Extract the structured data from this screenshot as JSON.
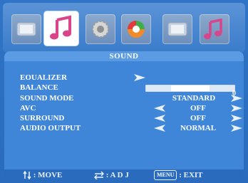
{
  "tabs": [
    {
      "icon": "picture-icon",
      "active": false
    },
    {
      "icon": "sound-music-icon",
      "active": true
    },
    {
      "icon": "settings-gear-icon",
      "active": false
    },
    {
      "icon": "color-disc-icon",
      "active": false
    },
    {
      "icon": "picture-icon",
      "active": false
    },
    {
      "icon": "sound-music-icon",
      "active": false
    }
  ],
  "menu": {
    "title": "SOUND",
    "items": [
      {
        "label": "EOUALIZER",
        "value": "",
        "has_left": false,
        "has_right": true
      },
      {
        "label": "BALANCE",
        "value": "0",
        "has_left": false,
        "has_right": false,
        "level": 0.5
      },
      {
        "label": "SOUND MODE",
        "value": "STANDARD",
        "has_left": false,
        "has_right": true
      },
      {
        "label": "AVC",
        "value": "OFF",
        "has_left": true,
        "has_right": true
      },
      {
        "label": "SURROUND",
        "value": "OFF",
        "has_left": true,
        "has_right": true
      },
      {
        "label": "AUDIO OUTPUT",
        "value": "NORMAL",
        "has_left": true,
        "has_right": true
      }
    ]
  },
  "footer": {
    "move_label": ": MOVE",
    "adj_label": ": A D J",
    "menu_key": "MENU",
    "exit_label": ": EXIT"
  },
  "colors": {
    "background": "#2b6fc0",
    "panel": "#3f86d8",
    "text": "#ffffff",
    "footer_text": "#1f3b63"
  }
}
